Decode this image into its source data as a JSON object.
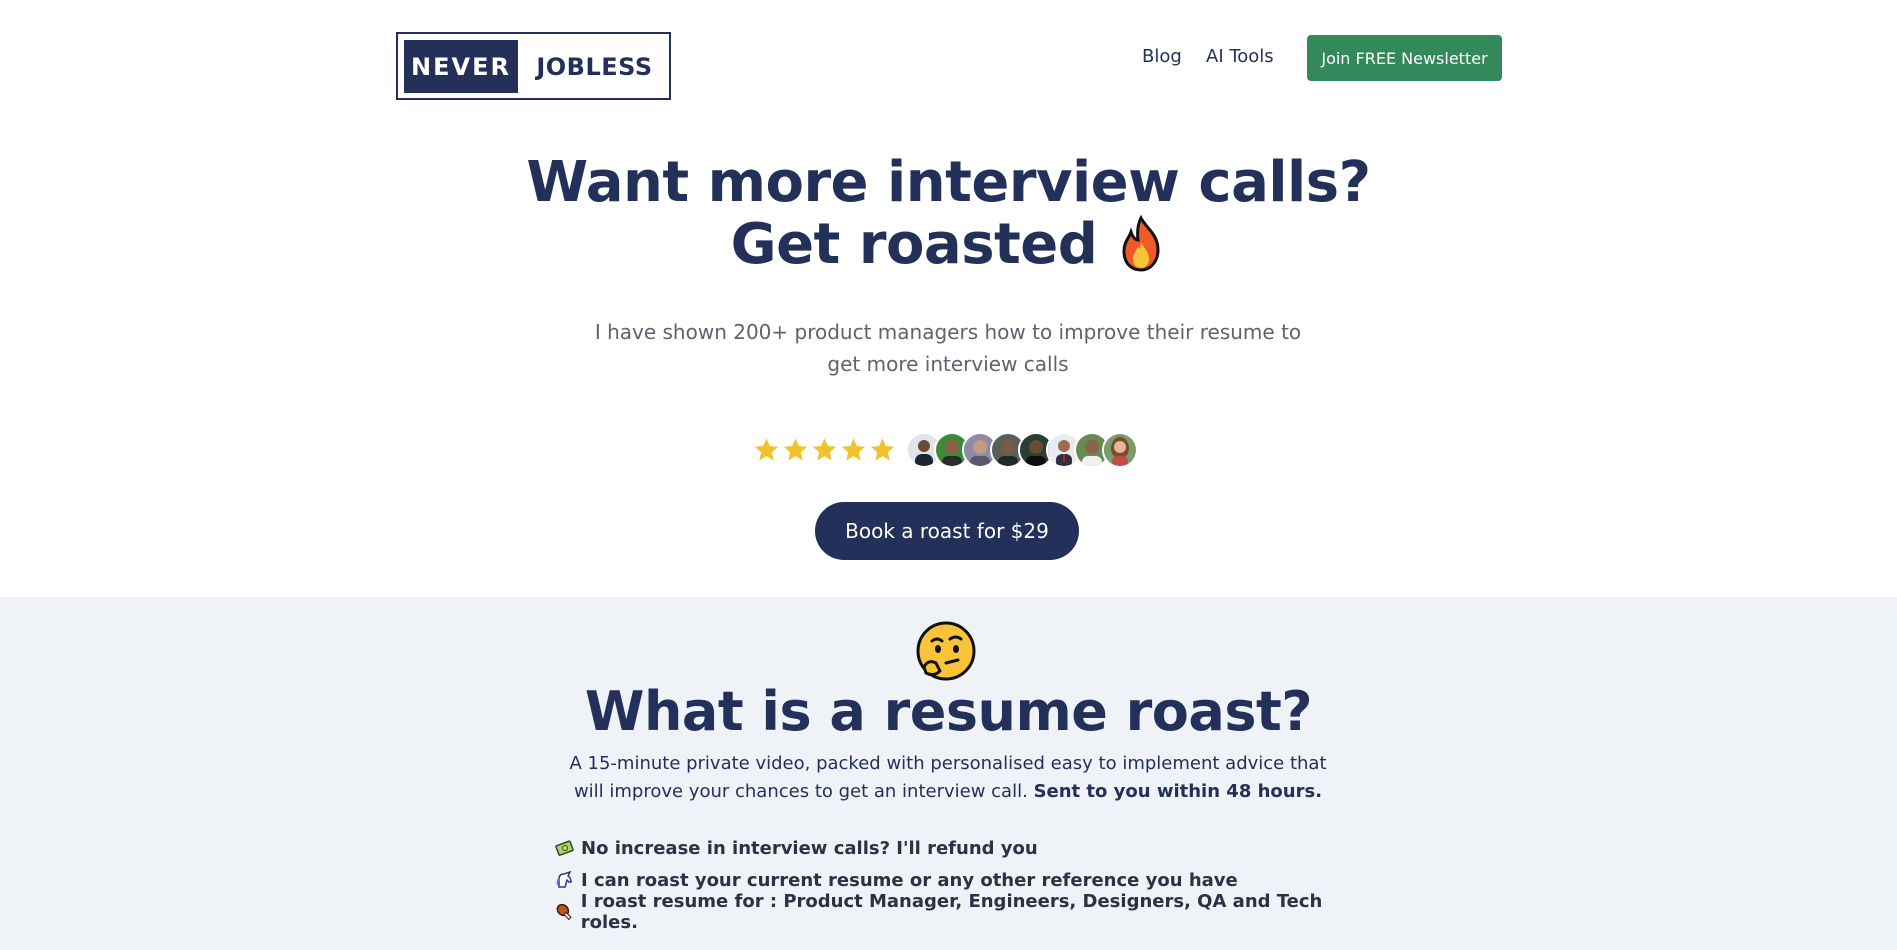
{
  "header": {
    "logo_left": "NEVER",
    "logo_right": "JOBLESS",
    "nav": {
      "blog": "Blog",
      "ai_tools": "AI Tools"
    },
    "newsletter_button": "Join FREE Newsletter"
  },
  "hero": {
    "title_line1": "Want more interview calls?",
    "title_line2": "Get roasted",
    "title_icon": "fire-icon",
    "subtitle": "I have shown 200+ product managers how to improve their resume to get more interview calls",
    "rating_stars": 5,
    "avatar_count": 8,
    "cta_button": "Book a roast for $29"
  },
  "section2": {
    "icon": "thinking-face-icon",
    "title": "What is a resume roast?",
    "desc_normal": "A 15-minute private video, packed with personalised easy to implement advice that will improve your chances to get an interview call.",
    "desc_bold": "Sent to you within 48 hours.",
    "bullets": [
      {
        "icon": "money-icon",
        "text": "No increase in interview calls? I'll refund you"
      },
      {
        "icon": "unicorn-icon",
        "text": "I can roast your current resume or any other reference you have"
      },
      {
        "icon": "drumstick-icon",
        "text": "I roast resume for : Product Manager, Engineers, Designers, QA and Tech roles."
      }
    ]
  },
  "colors": {
    "navy": "#233059",
    "green": "#33895a",
    "star": "#f2c12e",
    "section_bg": "#eff2f7"
  }
}
